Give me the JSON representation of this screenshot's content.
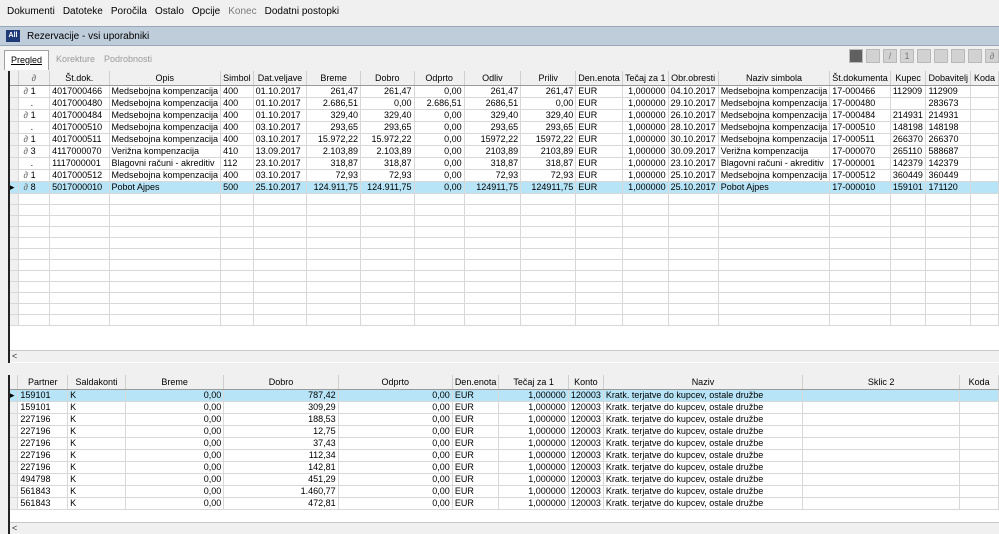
{
  "menu": [
    "Dokumenti",
    "Datoteke",
    "Poročila",
    "Ostalo",
    "Opcije",
    "Konec",
    "Dodatni postopki"
  ],
  "menu_disabled": [
    false,
    false,
    false,
    false,
    false,
    true,
    false
  ],
  "window": {
    "title": "Rezervacije - vsi uporabniki",
    "icon_text": "All"
  },
  "tabs": [
    "Pregled",
    "Korekture",
    "Podrobnosti"
  ],
  "toolbar_icons": [
    "grid-icon",
    "list-icon",
    "pencil-icon",
    "number-one-icon",
    "square-icon",
    "document-icon",
    "edit-icon",
    "copy-icon",
    "attachment-icon"
  ],
  "top_table": {
    "headers": [
      "",
      "Št.dok.",
      "Opis",
      "Simbol",
      "Dat.veljave",
      "Breme",
      "Dobro",
      "Odprto",
      "Odliv",
      "Priliv",
      "Den.enota",
      "Tečaj za 1",
      "Obr.obresti",
      "Naziv simbola",
      "Št.dokumenta",
      "Kupec",
      "Dobavitelj",
      "Koda"
    ],
    "rows": [
      {
        "n": "1",
        "clip": true,
        "c": [
          "4017000466",
          "Medsebojna kompenzacija",
          "400",
          "01.10.2017",
          "261,47",
          "261,47",
          "0,00",
          "261,47",
          "261,47",
          "EUR",
          "1,000000",
          "04.10.2017",
          "Medsebojna kompenzacija",
          "17-000466",
          "112909",
          "112909",
          ""
        ]
      },
      {
        "n": ".",
        "clip": false,
        "c": [
          "4017000480",
          "Medsebojna kompenzacija",
          "400",
          "01.10.2017",
          "2.686,51",
          "0,00",
          "2.686,51",
          "2686,51",
          "0,00",
          "EUR",
          "1,000000",
          "29.10.2017",
          "Medsebojna kompenzacija",
          "17-000480",
          "",
          "283673",
          ""
        ]
      },
      {
        "n": "1",
        "clip": true,
        "c": [
          "4017000484",
          "Medsebojna kompenzacija",
          "400",
          "01.10.2017",
          "329,40",
          "329,40",
          "0,00",
          "329,40",
          "329,40",
          "EUR",
          "1,000000",
          "26.10.2017",
          "Medsebojna kompenzacija",
          "17-000484",
          "214931",
          "214931",
          ""
        ]
      },
      {
        "n": ".",
        "clip": false,
        "c": [
          "4017000510",
          "Medsebojna kompenzacija",
          "400",
          "03.10.2017",
          "293,65",
          "293,65",
          "0,00",
          "293,65",
          "293,65",
          "EUR",
          "1,000000",
          "28.10.2017",
          "Medsebojna kompenzacija",
          "17-000510",
          "148198",
          "148198",
          ""
        ]
      },
      {
        "n": "1",
        "clip": true,
        "c": [
          "4017000511",
          "Medsebojna kompenzacija",
          "400",
          "03.10.2017",
          "15.972,22",
          "15.972,22",
          "0,00",
          "15972,22",
          "15972,22",
          "EUR",
          "1,000000",
          "30.10.2017",
          "Medsebojna kompenzacija",
          "17-000511",
          "266370",
          "266370",
          ""
        ]
      },
      {
        "n": "3",
        "clip": true,
        "c": [
          "4117000070",
          "Verižna kompenzacija",
          "410",
          "13.09.2017",
          "2.103,89",
          "2.103,89",
          "0,00",
          "2103,89",
          "2103,89",
          "EUR",
          "1,000000",
          "30.09.2017",
          "Verižna kompenzacija",
          "17-000070",
          "265110",
          "588687",
          ""
        ]
      },
      {
        "n": ".",
        "clip": false,
        "c": [
          "1117000001",
          "Blagovni računi - akreditiv",
          "112",
          "23.10.2017",
          "318,87",
          "318,87",
          "0,00",
          "318,87",
          "318,87",
          "EUR",
          "1,000000",
          "23.10.2017",
          "Blagovni računi - akreditiv",
          "17-000001",
          "142379",
          "142379",
          ""
        ]
      },
      {
        "n": "1",
        "clip": true,
        "c": [
          "4017000512",
          "Medsebojna kompenzacija",
          "400",
          "03.10.2017",
          "72,93",
          "72,93",
          "0,00",
          "72,93",
          "72,93",
          "EUR",
          "1,000000",
          "25.10.2017",
          "Medsebojna kompenzacija",
          "17-000512",
          "360449",
          "360449",
          ""
        ]
      },
      {
        "n": "8",
        "clip": true,
        "sel": true,
        "c": [
          "5017000010",
          "Pobot Ajpes",
          "500",
          "25.10.2017",
          "124.911,75",
          "124.911,75",
          "0,00",
          "124911,75",
          "124911,75",
          "EUR",
          "1,000000",
          "25.10.2017",
          "Pobot Ajpes",
          "17-000010",
          "159101",
          "171120",
          ""
        ]
      }
    ]
  },
  "bottom_table": {
    "headers": [
      "",
      "Partner",
      "Saldakonti",
      "Breme",
      "Dobro",
      "Odprto",
      "Den.enota",
      "Tečaj za 1",
      "Konto",
      "Naziv",
      "Sklic 2",
      "Koda"
    ],
    "rows": [
      {
        "sel": true,
        "c": [
          "159101",
          "K",
          "0,00",
          "787,42",
          "0,00",
          "EUR",
          "1,000000",
          "120003",
          "Kratk. terjatve do kupcev, ostale družbe",
          "",
          ""
        ]
      },
      {
        "c": [
          "159101",
          "K",
          "0,00",
          "309,29",
          "0,00",
          "EUR",
          "1,000000",
          "120003",
          "Kratk. terjatve do kupcev, ostale družbe",
          "",
          ""
        ]
      },
      {
        "c": [
          "227196",
          "K",
          "0,00",
          "188,53",
          "0,00",
          "EUR",
          "1,000000",
          "120003",
          "Kratk. terjatve do kupcev, ostale družbe",
          "",
          ""
        ]
      },
      {
        "c": [
          "227196",
          "K",
          "0,00",
          "12,75",
          "0,00",
          "EUR",
          "1,000000",
          "120003",
          "Kratk. terjatve do kupcev, ostale družbe",
          "",
          ""
        ]
      },
      {
        "c": [
          "227196",
          "K",
          "0,00",
          "37,43",
          "0,00",
          "EUR",
          "1,000000",
          "120003",
          "Kratk. terjatve do kupcev, ostale družbe",
          "",
          ""
        ]
      },
      {
        "c": [
          "227196",
          "K",
          "0,00",
          "112,34",
          "0,00",
          "EUR",
          "1,000000",
          "120003",
          "Kratk. terjatve do kupcev, ostale družbe",
          "",
          ""
        ]
      },
      {
        "c": [
          "227196",
          "K",
          "0,00",
          "142,81",
          "0,00",
          "EUR",
          "1,000000",
          "120003",
          "Kratk. terjatve do kupcev, ostale družbe",
          "",
          ""
        ]
      },
      {
        "c": [
          "494798",
          "K",
          "0,00",
          "451,29",
          "0,00",
          "EUR",
          "1,000000",
          "120003",
          "Kratk. terjatve do kupcev, ostale družbe",
          "",
          ""
        ]
      },
      {
        "c": [
          "561843",
          "K",
          "0,00",
          "1.460,77",
          "0,00",
          "EUR",
          "1,000000",
          "120003",
          "Kratk. terjatve do kupcev, ostale družbe",
          "",
          ""
        ]
      },
      {
        "c": [
          "561843",
          "K",
          "0,00",
          "472,81",
          "0,00",
          "EUR",
          "1,000000",
          "120003",
          "Kratk. terjatve do kupcev, ostale družbe",
          "",
          ""
        ]
      }
    ]
  },
  "scroll_arrow": "<",
  "row_marker": "▸"
}
